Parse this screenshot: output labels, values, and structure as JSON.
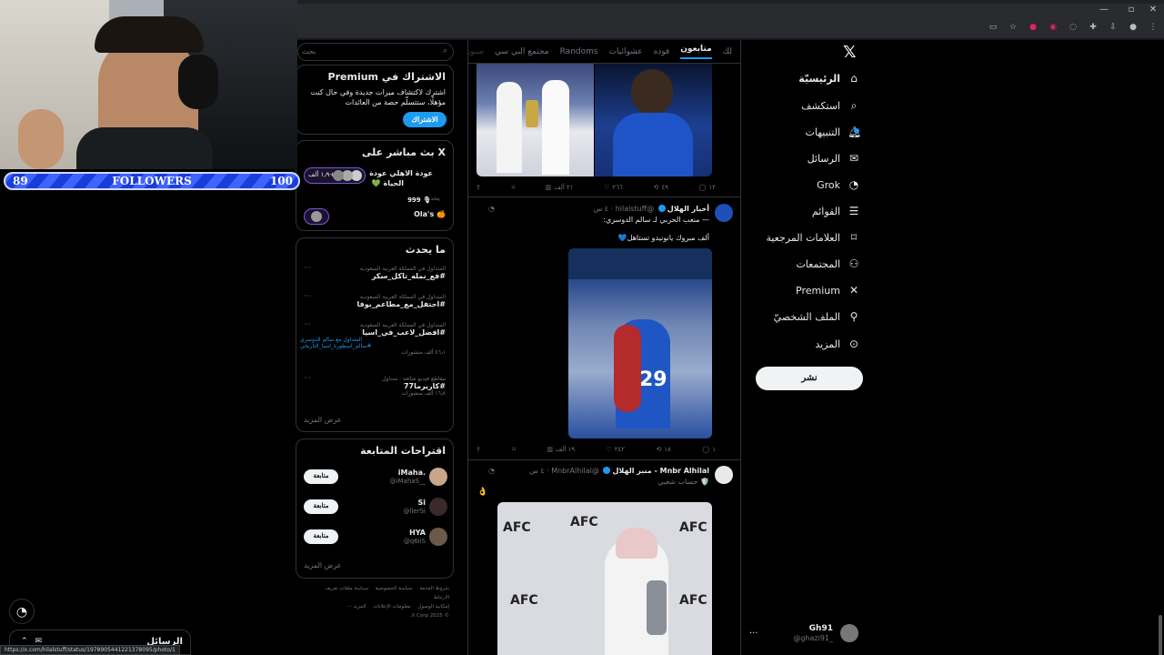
{
  "followers_bar": {
    "left": "89",
    "label": "FOLLOWERS",
    "right": "100"
  },
  "search": {
    "placeholder": "بحث"
  },
  "nav": {
    "items": [
      {
        "label": "الرئيسيّة",
        "icon": "home-icon"
      },
      {
        "label": "استكشف",
        "icon": "search-icon"
      },
      {
        "label": "التنبيهات",
        "icon": "bell-icon"
      },
      {
        "label": "الرسائل",
        "icon": "mail-icon"
      },
      {
        "label": "Grok",
        "icon": "grok-icon"
      },
      {
        "label": "القوائم",
        "icon": "list-icon"
      },
      {
        "label": "العلامات المرجعية",
        "icon": "bookmark-icon"
      },
      {
        "label": "المجتمعات",
        "icon": "people-icon"
      },
      {
        "label": "Premium",
        "icon": "x-logo-icon"
      },
      {
        "label": "الملف الشخصيّ",
        "icon": "person-icon"
      },
      {
        "label": "المزيد",
        "icon": "more-circle-icon"
      }
    ],
    "post_button": "نشر"
  },
  "me": {
    "name": "Gh91",
    "handle": "@ghazi91_",
    "more": "..."
  },
  "timeline": {
    "tabs": [
      "لك",
      "متابعون",
      "فوده",
      "عشوائيات",
      "Randoms",
      "مجتمع البي سي",
      "سبور"
    ],
    "active_tab": "متابعون",
    "tweet1_actions": {
      "reply": "١٢",
      "retweet": "٤٩",
      "like": "٢٦٦",
      "views": "٢١ ألف"
    },
    "tweet2": {
      "name": "أخبار الهلال",
      "handle": "@hilalstuff",
      "time": "٤ س",
      "line1": "— منعب الحربي لـ سالم الدوسري:",
      "line2": "ألف مبروك يانونيدو تستاهل💙",
      "actions": {
        "reply": "١",
        "retweet": "١٨",
        "like": "٢٤٢",
        "views": "١٩ ألف"
      }
    },
    "tweet3": {
      "name": "Mnbr Alhilal - منبر الهلال",
      "handle": "@MnbrAlhilal",
      "time": "٤ س",
      "sub": "🛡️ حساب شعبي",
      "text": "👌",
      "img_text": "AFC"
    }
  },
  "premium_card": {
    "title": "الاشتراك في Premium",
    "body1": "اشترك لاكتشاف ميزات جديدة وفي حال كنت",
    "body2": "مؤهلًا، ستتسلّم حصة من العائدات",
    "button": "الاشتراك"
  },
  "live_card": {
    "title": "X بث مباشر على",
    "space_title": "عودة الاهلي عودة",
    "space_title2": "الحياة 💚",
    "listeners": "١٫٩ ألف+",
    "speaking_label": "يتحدث:",
    "speaking_count": "999 🎙",
    "second": "Ola's 🍊"
  },
  "trends": {
    "title": "ما يحدث",
    "items": [
      {
        "cat": "المتداول في المملكة العربية السعودية",
        "name": "#فع_نمله_تاكل_سكر",
        "count": ""
      },
      {
        "cat": "المتداول في المملكة العربية السعودية",
        "name": "#احتفل_مع_مطاعم_بوفا",
        "count": ""
      },
      {
        "cat": "المتداول في المملكة العربية السعودية",
        "name": "#افضل_لاعب_في_اسيا",
        "count": "٤٦٫١ ألف منشورات",
        "related": "المتداول مع سالم الدوسري",
        "related2": "#سالم_اسطورة_اسيا_التاريخي"
      },
      {
        "cat": "مقاطع فيديو شائعة · متداول",
        "name": "#كاريرما77",
        "count": "١٦٫٨ ألف منشورات"
      }
    ],
    "more": "عرض المزيد"
  },
  "who_to_follow": {
    "title": "اقتراحات المتابعة",
    "items": [
      {
        "name": "iMaha.",
        "handle": "@iMahaS__",
        "button": "متابعة"
      },
      {
        "name": "Si",
        "handle": "@llerSi",
        "button": "متابعة"
      },
      {
        "name": "HYA",
        "handle": "@q6iiS",
        "button": "متابعة"
      }
    ],
    "more": "عرض المزيد"
  },
  "footer": {
    "links": [
      "شروط الخدمة",
      "سياسة الخصوصية",
      "سياسة ملفات تعريف الارتباط",
      "إمكانية الوصول",
      "معلومات الإعلانات",
      "المزيد ···"
    ],
    "copyright": "© 2025 X Corp."
  },
  "messages_drawer": {
    "title": "الرسائل"
  },
  "status_url": "https://x.com/hilalstuff/status/1978905441221378095/photo/1",
  "colors": {
    "accent": "#1d9bf0",
    "bg": "#000000",
    "border": "#2f3336",
    "text": "#e7e9ea",
    "muted": "#71767b"
  }
}
